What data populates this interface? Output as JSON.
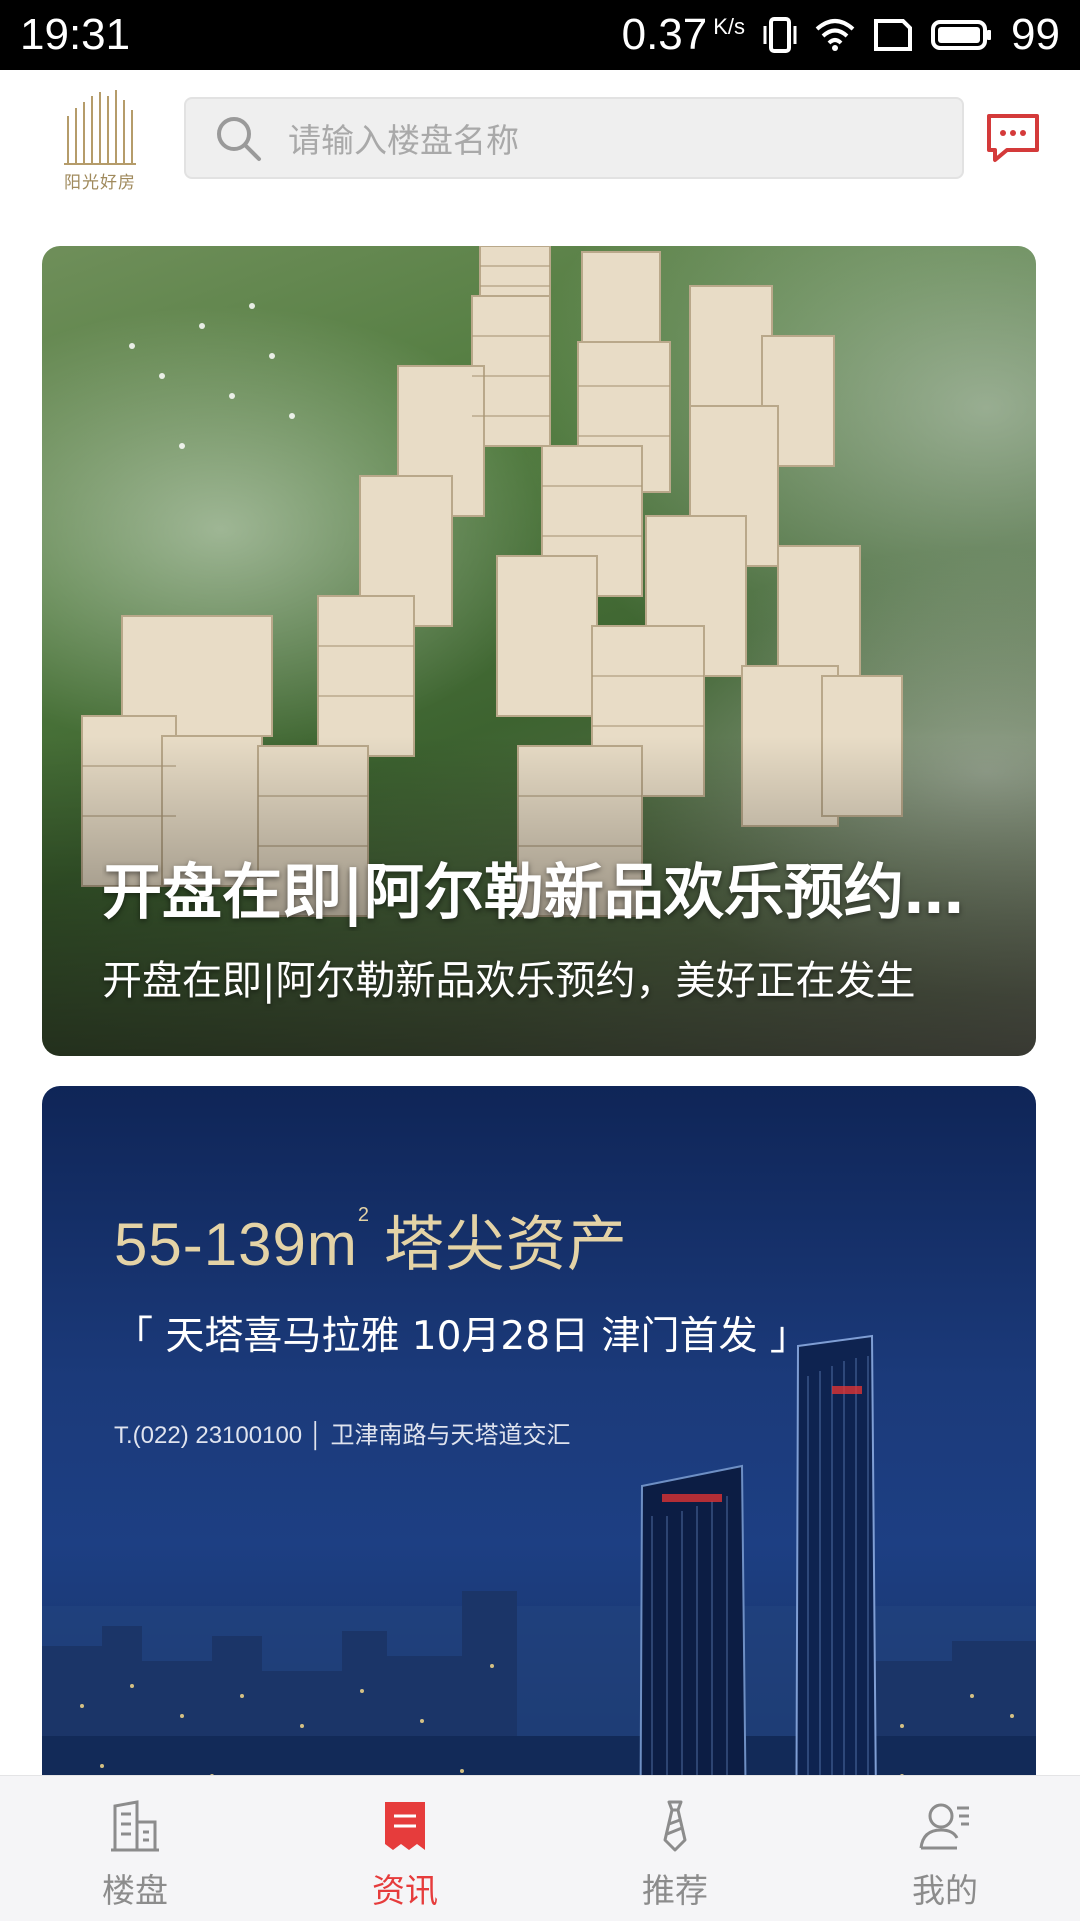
{
  "status_bar": {
    "time": "19:31",
    "net_speed": "0.37",
    "net_unit": "K/s",
    "battery": "99",
    "icons": [
      "vibrate-icon",
      "wifi-icon",
      "sim-icon",
      "battery-icon"
    ]
  },
  "header": {
    "logo_text": "阳光好房",
    "search_placeholder": "请输入楼盘名称",
    "icons": {
      "search": "search-icon",
      "message": "message-icon"
    }
  },
  "cards": [
    {
      "title": "开盘在即|阿尔勒新品欢乐预约，美好正在发生",
      "subtitle": "开盘在即|阿尔勒新品欢乐预约，美好正在发生"
    },
    {
      "ad_headline": "55-139m",
      "ad_headline_sup": "2",
      "ad_headline_tail": "塔尖资产",
      "ad_sub": "「 天塔喜马拉雅 10月28日 津门首发 」",
      "ad_contact": "T.(022) 23100100 │ 卫津南路与天塔道交汇"
    }
  ],
  "bottom_nav": {
    "active_index": 1,
    "items": [
      {
        "label": "楼盘",
        "icon": "building-icon"
      },
      {
        "label": "资讯",
        "icon": "news-icon"
      },
      {
        "label": "推荐",
        "icon": "tie-icon"
      },
      {
        "label": "我的",
        "icon": "profile-icon"
      }
    ]
  },
  "colors": {
    "accent": "#e63c3c",
    "nav_inactive": "#8c8c8c",
    "logo_gold": "#a08a5c",
    "ad_gold": "#e4d3a6"
  }
}
